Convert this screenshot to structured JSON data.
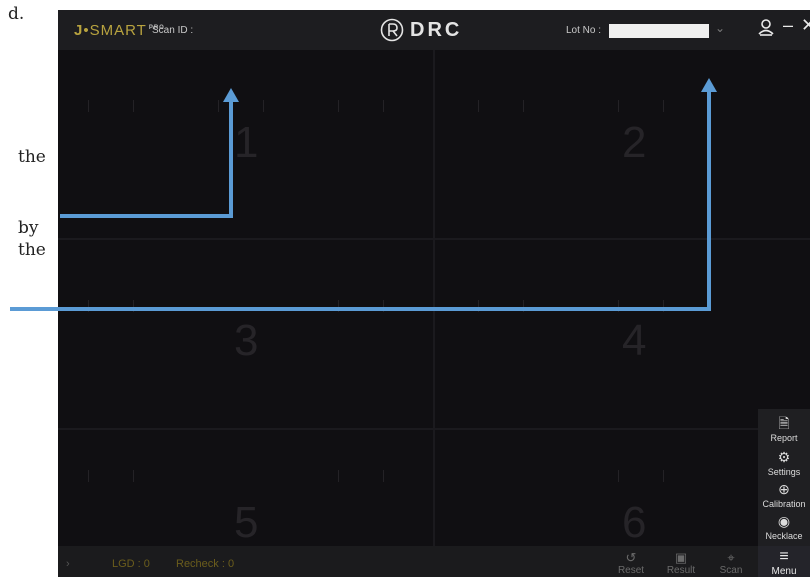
{
  "doc": {
    "fragment_1": "d.",
    "fragment_2": "the",
    "fragment_3": "by",
    "fragment_4": "the"
  },
  "app": {
    "brand": {
      "prefix": "J",
      "name": "SMART",
      "sup": "PRO"
    },
    "scan_id_label": "Scan ID :",
    "logo_text": "DRC",
    "lot_label": "Lot No :",
    "lot_value": "",
    "quadrants": [
      "1",
      "2",
      "3",
      "4",
      "5",
      "6"
    ],
    "side_menu": [
      "Report",
      "Settings",
      "Calibration",
      "Necklace"
    ],
    "status": {
      "lgd": "LGD :  0",
      "recheck": "Recheck :  0"
    },
    "bottom_buttons": [
      "Reset",
      "Result",
      "Scan"
    ],
    "menu_label": "Menu"
  },
  "colors": {
    "background": "#0f0f11",
    "accent_gold": "#b8a33f",
    "annotation_arrow": "#5b9bd5"
  }
}
